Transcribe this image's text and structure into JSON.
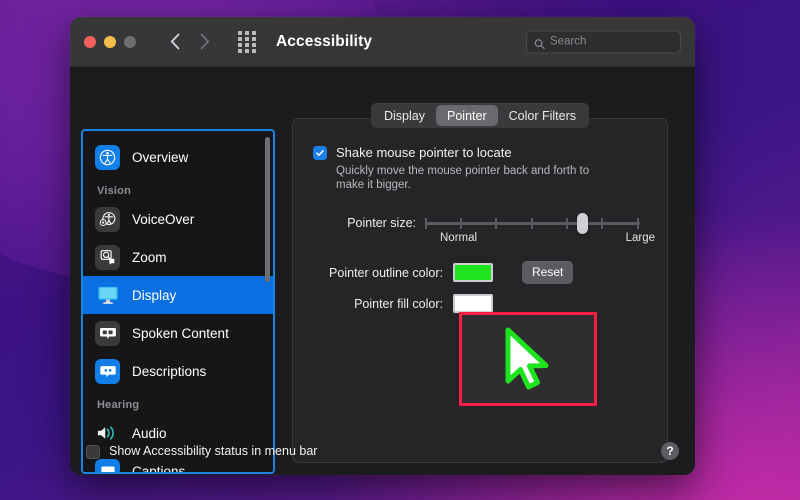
{
  "window": {
    "title": "Accessibility",
    "traffic_lights": [
      "close-red",
      "minimize-yellow",
      "zoom-gray"
    ],
    "back_label": "Back",
    "forward_label": "Forward",
    "grid_label": "All settings",
    "search": {
      "placeholder": "Search",
      "value": ""
    }
  },
  "sidebar": {
    "scrollbar": true,
    "items": [
      {
        "label": "Overview",
        "icon": "accessibility-icon",
        "type": "item",
        "selected": false,
        "icon_style": "blue"
      },
      {
        "label": "Vision",
        "icon": "",
        "type": "group"
      },
      {
        "label": "VoiceOver",
        "icon": "voiceover-icon",
        "type": "item",
        "selected": false,
        "icon_style": "dark"
      },
      {
        "label": "Zoom",
        "icon": "zoom-magnifier-icon",
        "type": "item",
        "selected": false,
        "icon_style": "dark"
      },
      {
        "label": "Display",
        "icon": "display-monitor-icon",
        "type": "item",
        "selected": true,
        "icon_style": "plain"
      },
      {
        "label": "Spoken Content",
        "icon": "speech-bubble-icon",
        "type": "item",
        "selected": false,
        "icon_style": "dark"
      },
      {
        "label": "Descriptions",
        "icon": "descriptions-icon",
        "type": "item",
        "selected": false,
        "icon_style": "blue"
      },
      {
        "label": "Hearing",
        "icon": "",
        "type": "group"
      },
      {
        "label": "Audio",
        "icon": "speaker-icon",
        "type": "item",
        "selected": false,
        "icon_style": "plain"
      },
      {
        "label": "Captions",
        "icon": "captions-icon",
        "type": "item",
        "selected": false,
        "icon_style": "blue"
      }
    ]
  },
  "content": {
    "tabs": [
      {
        "label": "Display",
        "active": false
      },
      {
        "label": "Pointer",
        "active": true
      },
      {
        "label": "Color Filters",
        "active": false
      }
    ],
    "shake": {
      "label": "Shake mouse pointer to locate",
      "description": "Quickly move the mouse pointer back and forth to make it bigger.",
      "checked": true
    },
    "pointer_size": {
      "label": "Pointer size:",
      "min_label": "Normal",
      "max_label": "Large",
      "ticks": 7,
      "value_percent": 73
    },
    "outline_color": {
      "label": "Pointer outline color:",
      "color": "#1FE31F"
    },
    "fill_color": {
      "label": "Pointer fill color:",
      "color": "#FFFFFF"
    },
    "reset_button": "Reset",
    "preview": {
      "cursor_outline": "#1FE31F",
      "cursor_fill": "#FFFFFF",
      "annotation_color": "#F41F43"
    }
  },
  "footer": {
    "menubar_checkbox": {
      "label": "Show Accessibility status in menu bar",
      "checked": false
    },
    "help_label": "?"
  },
  "annotations": {
    "sidebar_highlight_color": "#1B83E4",
    "preview_highlight_color": "#F41F43"
  }
}
